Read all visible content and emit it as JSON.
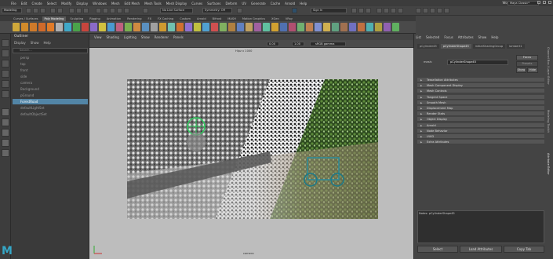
{
  "menu": [
    "File",
    "Edit",
    "Create",
    "Select",
    "Modify",
    "Display",
    "Windows",
    "Mesh",
    "Edit Mesh",
    "Mesh Tools",
    "Mesh Display",
    "Curves",
    "Surfaces",
    "Deform",
    "UV",
    "Generate",
    "Cache",
    "Arnold",
    "Help"
  ],
  "workspace": {
    "label": "Workspace :",
    "value": "Maya Classic*"
  },
  "status": {
    "mode": "Modeling",
    "live": "No Live Surface",
    "symmetry": "Symmetry: Off",
    "signin": "Sign In"
  },
  "shelf_tabs": [
    "Curves / Surfaces",
    "Poly Modeling",
    "Sculpting",
    "Rigging",
    "Animation",
    "Rendering",
    "FX",
    "FX Caching",
    "Custom",
    "Arnold",
    "Bifrost",
    "MASH",
    "Motion Graphics",
    "XGen",
    "VRay"
  ],
  "shelf_active": "Poly Modeling",
  "shelf_icon_colors": [
    "#cfa83a",
    "#d08a2a",
    "#cf7a2a",
    "#d06a2a",
    "#e07b28",
    "#b0b0b0",
    "#3fa8c8",
    "#4aa34a",
    "#c8453d",
    "#8a6ac8",
    "#d0c040",
    "#4a9ad0",
    "#c06080",
    "#7ab050",
    "#d08a40",
    "#5a90c0",
    "#a0a0a0",
    "#cf9a30",
    "#70c0b0",
    "#d07030",
    "#9070d0",
    "#c0c040",
    "#50a0d0",
    "#d05050",
    "#80b060",
    "#b08040",
    "#6080c0",
    "#c0a060",
    "#a060a0",
    "#60c0a0",
    "#d0a030",
    "#5070b0",
    "#b05070",
    "#70b070",
    "#c08050",
    "#8090d0",
    "#d0b050",
    "#60a080",
    "#a07050",
    "#7070c0",
    "#c07040",
    "#50b0b0",
    "#b0a040",
    "#9060b0",
    "#60b060"
  ],
  "outliner": {
    "title": "Outliner",
    "menu": [
      "Display",
      "Show",
      "Help"
    ],
    "search_placeholder": "Search...",
    "items": [
      {
        "label": "persp",
        "selected": false
      },
      {
        "label": "top",
        "selected": false
      },
      {
        "label": "front",
        "selected": false
      },
      {
        "label": "side",
        "selected": false
      },
      {
        "label": "camera",
        "selected": false
      },
      {
        "label": "Background",
        "selected": false
      },
      {
        "label": "pGround",
        "selected": false
      },
      {
        "label": "ForestRoad",
        "selected": true
      },
      {
        "label": "defaultLightSet",
        "selected": false
      },
      {
        "label": "defaultObjectSet",
        "selected": false
      }
    ]
  },
  "viewport": {
    "menu": [
      "View",
      "Shading",
      "Lighting",
      "Show",
      "Renderer",
      "Panels"
    ],
    "num1": "0.00",
    "num2": "1.00",
    "gamma": "sRGB gamma",
    "hud_top": "Hipz x 1000",
    "camera_label": "camera"
  },
  "attr": {
    "menu": [
      "List",
      "Selected",
      "Focus",
      "Attributes",
      "Show",
      "Help"
    ],
    "tabs": [
      "pCylinder45",
      "pCylinderShape45",
      "initialShadingGroup",
      "lambert1"
    ],
    "tabs_active": "pCylinderShape45",
    "mesh_label": "mesh:",
    "mesh_value": "pCylinderShape45",
    "focus_btn": "Focus",
    "presets_btn": "Presets",
    "show_btn": "Show",
    "hide_btn": "Hide",
    "sections": [
      "Tessellation Attributes",
      "Mesh Component Display",
      "Mesh Controls",
      "Tangent Space",
      "Smooth Mesh",
      "Displacement Map",
      "Render Stats",
      "Object Display",
      "Arnold",
      "Node Behavior",
      "UUID",
      "Extra Attributes"
    ],
    "notes_label": "Notes: pCylinderShape45",
    "buttons": [
      "Select",
      "Load Attributes",
      "Copy Tab"
    ]
  },
  "side_tabs": [
    "Channel Box / Layer Editor",
    "Modeling Toolkit",
    "Attribute Editor"
  ]
}
